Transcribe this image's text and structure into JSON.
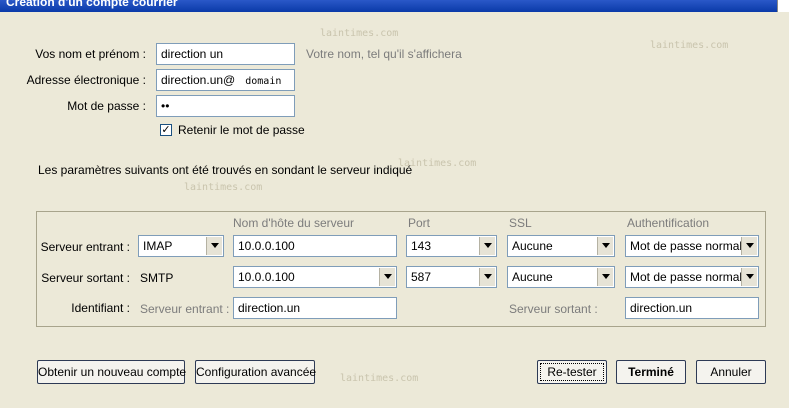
{
  "window": {
    "title": "Création d'un compte courrier"
  },
  "watermark": "laintimes.com",
  "form": {
    "name_label": "Vos nom et prénom :",
    "name_value": "direction un",
    "name_hint": "Votre nom, tel qu'il s'affichera",
    "email_label": "Adresse électronique :",
    "email_value": "direction.un@",
    "email_domain": "domain",
    "password_label": "Mot de passe :",
    "password_value": "••",
    "remember_label": "Retenir le mot de passe",
    "remember_checked": true
  },
  "info_text": "Les paramètres suivants ont été trouvés en sondant le serveur indiqué",
  "server": {
    "headers": {
      "hostname": "Nom d'hôte du serveur",
      "port": "Port",
      "ssl": "SSL",
      "auth": "Authentification"
    },
    "incoming": {
      "label": "Serveur entrant :",
      "protocol": "IMAP",
      "hostname": "10.0.0.100",
      "port": "143",
      "ssl": "Aucune",
      "auth": "Mot de passe normal"
    },
    "outgoing": {
      "label": "Serveur sortant :",
      "protocol": "SMTP",
      "hostname": "10.0.0.100",
      "port": "587",
      "ssl": "Aucune",
      "auth": "Mot de passe normal"
    },
    "identifier": {
      "label": "Identifiant :",
      "incoming_label": "Serveur entrant :",
      "incoming_value": "direction.un",
      "outgoing_label": "Serveur sortant :",
      "outgoing_value": "direction.un"
    }
  },
  "buttons": {
    "new_account": "Obtenir un nouveau compte",
    "advanced": "Configuration avancée",
    "retest": "Re-tester",
    "done": "Terminé",
    "cancel": "Annuler"
  }
}
